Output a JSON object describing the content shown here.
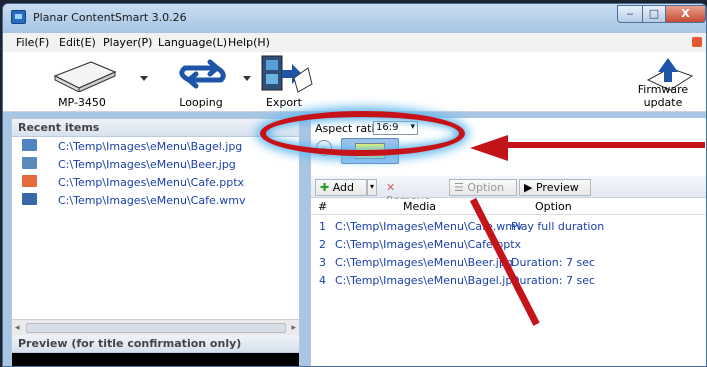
{
  "window": {
    "title": "Planar ContentSmart 3.0.26",
    "minimize": "‒",
    "maximize": "□",
    "close": "X"
  },
  "menu": [
    "File(F)",
    "Edit(E)",
    "Player(P)",
    "Language(L)",
    "Help(H)"
  ],
  "toolbar": {
    "player": "MP-3450",
    "looping": "Looping",
    "export": "Export",
    "firmware": "Firmware update"
  },
  "recent": {
    "header": "Recent items",
    "items": [
      {
        "text": "C:\\Temp\\Images\\eMenu\\Bagel.jpg",
        "icon": "image-file-icon",
        "color": "#4f86c1"
      },
      {
        "text": "C:\\Temp\\Images\\eMenu\\Beer.jpg",
        "icon": "image-file-icon",
        "color": "#5d8bb9"
      },
      {
        "text": "C:\\Temp\\Images\\eMenu\\Cafe.pptx",
        "icon": "powerpoint-file-icon",
        "color": "#e5693b"
      },
      {
        "text": "C:\\Temp\\Images\\eMenu\\Cafe.wmv",
        "icon": "video-file-icon",
        "color": "#3a67a8"
      }
    ]
  },
  "preview": {
    "header": "Preview (for title confirmation only)"
  },
  "aspect": {
    "label": "Aspect ratio",
    "value": "16:9"
  },
  "media_bar": {
    "add": "Add",
    "remove": "Remove",
    "option": "Option",
    "preview": "Preview"
  },
  "media_list": {
    "columns": [
      "#",
      "Media",
      "Option"
    ],
    "rows": [
      {
        "n": "1",
        "media": "C:\\Temp\\Images\\eMenu\\Cafe.wmv",
        "option": "Play full duration"
      },
      {
        "n": "2",
        "media": "C:\\Temp\\Images\\eMenu\\Cafe.pptx",
        "option": ""
      },
      {
        "n": "3",
        "media": "C:\\Temp\\Images\\eMenu\\Beer.jpg",
        "option": "Duration: 7 sec"
      },
      {
        "n": "4",
        "media": "C:\\Temp\\Images\\eMenu\\Bagel.jpg",
        "option": "Duration: 7 sec"
      }
    ]
  },
  "colors": {
    "annotation": "#c4141a",
    "glow": "#63b8ee",
    "link": "#1b3fa8"
  }
}
